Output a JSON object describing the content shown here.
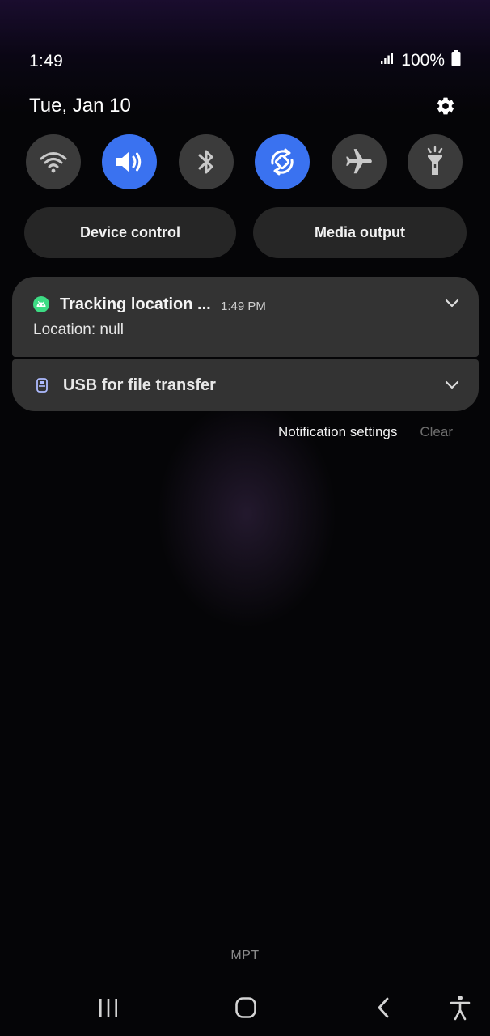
{
  "status_bar": {
    "time": "1:49",
    "battery": "100%",
    "icons": [
      "signal-icon",
      "battery-icon"
    ]
  },
  "header": {
    "date": "Tue, Jan 10",
    "settings_icon": "gear-icon"
  },
  "quick_toggles": [
    {
      "name": "wifi",
      "icon": "wifi-icon",
      "active": false
    },
    {
      "name": "sound",
      "icon": "sound-icon",
      "active": true
    },
    {
      "name": "bluetooth",
      "icon": "bluetooth-icon",
      "active": false
    },
    {
      "name": "auto-rotate",
      "icon": "auto-rotate-icon",
      "active": true
    },
    {
      "name": "airplane-mode",
      "icon": "airplane-icon",
      "active": false
    },
    {
      "name": "flashlight",
      "icon": "flashlight-icon",
      "active": false
    }
  ],
  "pills": {
    "device_control": "Device control",
    "media_output": "Media output"
  },
  "notifications": [
    {
      "app_icon": "android-icon",
      "title": "Tracking location ...",
      "time": "1:49 PM",
      "body": "Location: null"
    },
    {
      "app_icon": "usb-icon",
      "title": "USB for file transfer"
    }
  ],
  "notification_actions": {
    "settings": "Notification settings",
    "clear": "Clear"
  },
  "carrier": "MPT",
  "nav_bar": [
    "recents-icon",
    "home-icon",
    "back-icon",
    "accessibility-icon"
  ],
  "colors": {
    "accent": "#3a72f0",
    "toggle_off": "#3b3b3b",
    "card": "#333333",
    "android_green": "#3ddc84"
  }
}
